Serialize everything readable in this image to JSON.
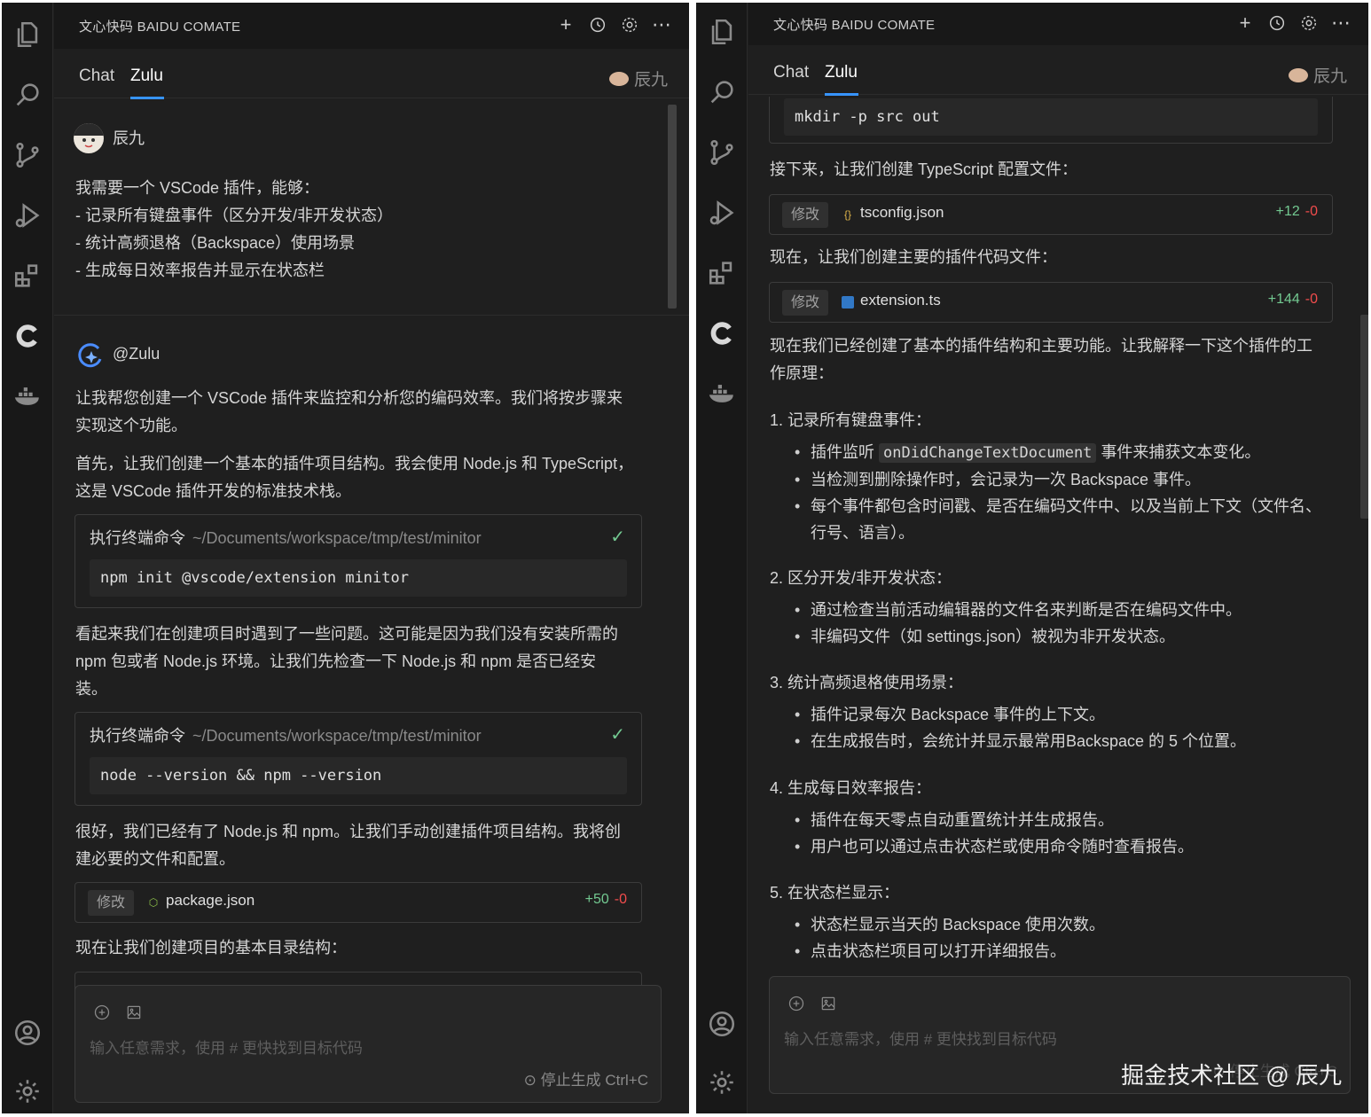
{
  "colors": {
    "accent": "#3794ff",
    "diff_add": "#73c991",
    "diff_del": "#f14c4c",
    "check": "#73c991"
  },
  "app": {
    "title": "文心快码 BAIDU COMATE",
    "tabs": [
      "Chat",
      "Zulu"
    ],
    "active_tab": "Zulu",
    "user": "辰九",
    "input_placeholder": "输入任意需求，使用 # 更快找到目标代码",
    "stop_label": "停止生成 Ctrl+C"
  },
  "activity_icons": [
    "explorer-icon",
    "search-icon",
    "source-control-icon",
    "run-debug-icon",
    "extensions-icon",
    "comate-icon",
    "docker-icon",
    "account-icon",
    "settings-icon"
  ],
  "left": {
    "user_name": "辰九",
    "user_message": [
      "我需要一个 VSCode 插件，能够：",
      "- 记录所有键盘事件（区分开发/非开发状态）",
      "- 统计高频退格（Backspace）使用场景",
      "- 生成每日效率报告并显示在状态栏"
    ],
    "bot_name": "@Zulu",
    "p1": [
      "让我帮您创建一个 VSCode 插件来监控和分析您的编码效率。我们将按步骤来",
      "实现这个功能。"
    ],
    "p2": [
      "首先，让我们创建一个基本的插件项目结构。我会使用 Node.js 和 TypeScript，",
      "这是 VSCode 插件开发的标准技术栈。"
    ],
    "cmd1": {
      "label": "执行终端命令",
      "path": "~/Documents/workspace/tmp/test/minitor",
      "code": "npm init @vscode/extension minitor"
    },
    "p3": [
      "看起来我们在创建项目时遇到了一些问题。这可能是因为我们没有安装所需的",
      "npm 包或者 Node.js 环境。让我们先检查一下 Node.js 和 npm 是否已经安",
      "装。"
    ],
    "cmd2": {
      "label": "执行终端命令",
      "path": "~/Documents/workspace/tmp/test/minitor",
      "code": "node --version && npm --version"
    },
    "p4": [
      "很好，我们已经有了 Node.js 和 npm。让我们手动创建插件项目结构。我将创",
      "建必要的文件和配置。"
    ],
    "file1": {
      "badge": "修改",
      "name": "package.json",
      "add": "+50",
      "del": "-0"
    },
    "p5": "现在让我们创建项目的基本目录结构："
  },
  "right": {
    "code_top": "mkdir -p src out",
    "p1": "接下来，让我们创建 TypeScript 配置文件：",
    "file1": {
      "badge": "修改",
      "name": "tsconfig.json",
      "add": "+12",
      "del": "-0"
    },
    "p2": "现在，让我们创建主要的插件代码文件：",
    "file2": {
      "badge": "修改",
      "name": "extension.ts",
      "add": "+144",
      "del": "-0"
    },
    "p3": [
      "现在我们已经创建了基本的插件结构和主要功能。让我解释一下这个插件的工",
      "作原理："
    ],
    "sections": [
      {
        "title": "1. 记录所有键盘事件：",
        "items": [
          "插件监听",
          "当检测到删除操作时，会记录为一次 Backspace 事件。",
          "每个事件都包含时间戳、是否在编码文件中、以及当前上下文（文件名、行号、语言）。"
        ]
      },
      {
        "title": "2. 区分开发/非开发状态：",
        "items": [
          "通过检查当前活动编辑器的文件名来判断是否在编码文件中。",
          "非编码文件（如 settings.json）被视为非开发状态。"
        ]
      },
      {
        "title": "3. 统计高频退格使用场景：",
        "items": [
          "插件记录每次 Backspace 事件的上下文。",
          "在生成报告时，会统计并显示最常用Backspace 的 5 个位置。"
        ]
      },
      {
        "title": "4. 生成每日效率报告：",
        "items": [
          "插件在每天零点自动重置统计并生成报告。",
          "用户也可以通过点击状态栏或使用命令随时查看报告。"
        ]
      },
      {
        "title": "5. 在状态栏显示：",
        "items": [
          "状态栏显示当天的 Backspace 使用次数。",
          "点击状态栏项目可以打开详细报告。"
        ]
      }
    ],
    "inline_code": "onDidChangeTextDocument",
    "inline_suffix": "事件来捕获文本变化。",
    "item3a": "每个事件都包含时间戳、是否在编码文件中、以及当前上下文（文件名、",
    "item3b": "行号、语言）。",
    "stop_partial": "停止生成 Ctrl+C",
    "watermark": "掘金技术社区 @ 辰九"
  }
}
